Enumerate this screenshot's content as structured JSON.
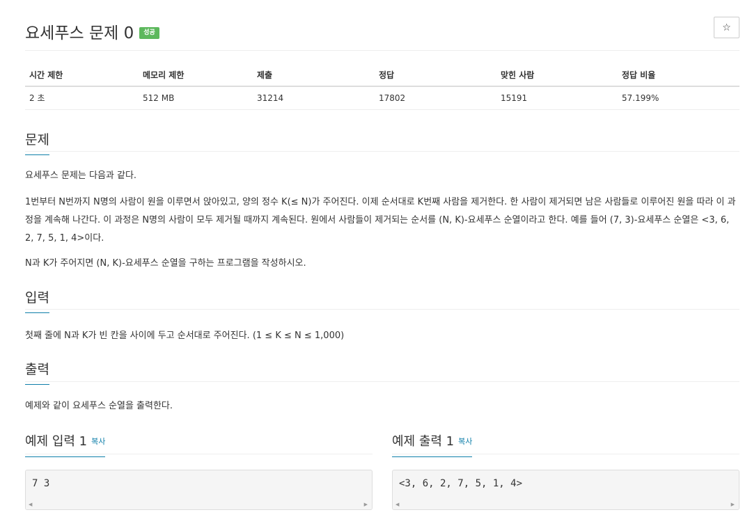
{
  "problem": {
    "title": "요세푸스 문제 0",
    "status_badge": "성공",
    "star_icon": "☆"
  },
  "info_table": {
    "headers": [
      "시간 제한",
      "메모리 제한",
      "제출",
      "정답",
      "맞힌 사람",
      "정답 비율"
    ],
    "values": [
      "2 초",
      "512 MB",
      "31214",
      "17802",
      "15191",
      "57.199%"
    ]
  },
  "sections": {
    "problem": {
      "title": "문제",
      "paragraphs": [
        "요세푸스 문제는 다음과 같다.",
        "1번부터 N번까지 N명의 사람이 원을 이루면서 앉아있고, 양의 정수 K(≤ N)가 주어진다. 이제 순서대로 K번째 사람을 제거한다. 한 사람이 제거되면 남은 사람들로 이루어진 원을 따라 이 과정을 계속해 나간다. 이 과정은 N명의 사람이 모두 제거될 때까지 계속된다. 원에서 사람들이 제거되는 순서를 (N, K)-요세푸스 순열이라고 한다. 예를 들어 (7, 3)-요세푸스 순열은 <3, 6, 2, 7, 5, 1, 4>이다.",
        "N과 K가 주어지면 (N, K)-요세푸스 순열을 구하는 프로그램을 작성하시오."
      ]
    },
    "input": {
      "title": "입력",
      "text": "첫째 줄에 N과 K가 빈 칸을 사이에 두고 순서대로 주어진다. (1 ≤ K ≤ N ≤ 1,000)"
    },
    "output": {
      "title": "출력",
      "text": "예제와 같이 요세푸스 순열을 출력한다."
    }
  },
  "samples": {
    "input": {
      "title": "예제 입력 1",
      "copy_label": "복사",
      "content": "7 3"
    },
    "output": {
      "title": "예제 출력 1",
      "copy_label": "복사",
      "content": "<3, 6, 2, 7, 5, 1, 4>"
    }
  }
}
